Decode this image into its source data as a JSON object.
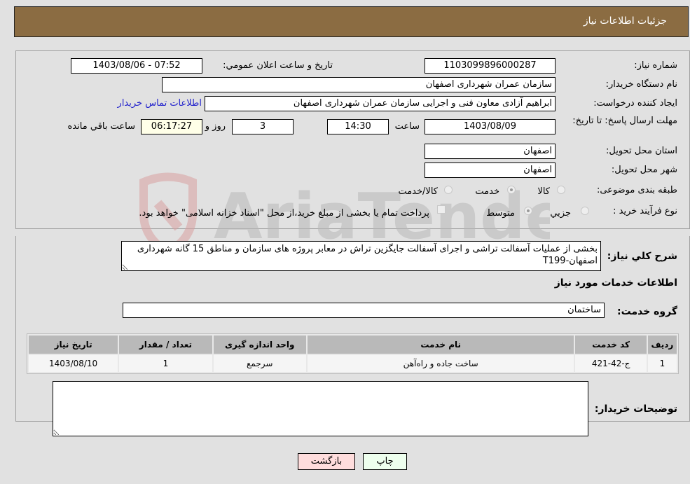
{
  "header": {
    "title": "جزئیات اطلاعات نیاز"
  },
  "form": {
    "need_number": {
      "label": "شماره نیاز:",
      "value": "1103099896000287"
    },
    "announce_datetime": {
      "label": "تاریخ و ساعت اعلان عمومي:",
      "value": "1403/08/06 - 07:52"
    },
    "buyer_org": {
      "label": "نام دستگاه خریدار:",
      "value": "سازمان عمران شهرداری اصفهان"
    },
    "requester": {
      "label": "ایجاد کننده درخواست:",
      "value": "ابراهیم آزادی معاون فنی و اجرایی سازمان عمران شهرداری اصفهان"
    },
    "buyer_contact_link": "اطلاعات تماس خریدار",
    "deadline": {
      "label": "مهلت ارسال پاسخ: تا تاریخ:",
      "date": "1403/08/09",
      "time_label": "ساعت",
      "time": "14:30",
      "days": "3",
      "days_label": "روز و",
      "remaining": "06:17:27",
      "remaining_label": "ساعت باقي مانده"
    },
    "province": {
      "label": "استان محل تحویل:",
      "value": "اصفهان"
    },
    "city": {
      "label": "شهر محل تحویل:",
      "value": "اصفهان"
    },
    "category": {
      "label": "طبقه بندی موضوعی:",
      "options": [
        "کالا",
        "خدمت",
        "کالا/خدمت"
      ],
      "selected": "خدمت"
    },
    "purchase_type": {
      "label": "نوع فرآیند خرید :",
      "options": [
        "جزيي",
        "متوسط"
      ],
      "selected": "متوسط",
      "treasury_note": "پرداخت تمام یا بخشی از مبلغ خرید،از محل \"اسناد خزانه اسلامی\" خواهد بود."
    }
  },
  "description": {
    "label": "شرح كلي نياز:",
    "value": "بخشی از عملیات آسفالت تراشی و اجرای آسفالت جایگزین تراش در معابر پروژه های سازمان و مناطق 15 گانه شهرداری اصفهان-T199"
  },
  "services": {
    "section_title": "اطلاعات خدمات مورد نیاز",
    "group_label": "گروه خدمت:",
    "group_value": "ساختمان",
    "table": {
      "headers": [
        "ردیف",
        "کد خدمت",
        "نام خدمت",
        "واحد اندازه گیری",
        "تعداد / مقدار",
        "تاریخ نیاز"
      ],
      "rows": [
        [
          "1",
          "ج-42-421",
          "ساخت جاده و راه‌آهن",
          "سرجمع",
          "1",
          "1403/08/10"
        ]
      ]
    }
  },
  "buyer_notes": {
    "label": "توضیحات خریدار:",
    "value": ""
  },
  "buttons": {
    "print": "چاپ",
    "back": "بازگشت"
  },
  "watermark": {
    "text": "AriaTender.neT"
  },
  "colors": {
    "header_bg": "#8b6c42",
    "print_bg": "#eeffee",
    "back_bg": "#ffdddd",
    "link": "#2222cc"
  }
}
